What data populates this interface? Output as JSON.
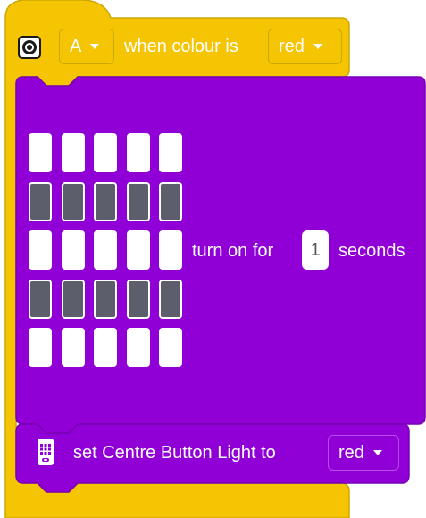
{
  "hat_block": {
    "port": "A",
    "label": "when colour is",
    "colour": "red"
  },
  "matrix_block": {
    "grid": [
      [
        0,
        0,
        0,
        0,
        0
      ],
      [
        1,
        1,
        1,
        1,
        1
      ],
      [
        0,
        0,
        0,
        0,
        0
      ],
      [
        1,
        1,
        1,
        1,
        1
      ],
      [
        0,
        0,
        0,
        0,
        0
      ]
    ],
    "label_prefix": "turn on for",
    "duration": "1",
    "label_suffix": "seconds"
  },
  "light_block": {
    "label": "set Centre Button Light to",
    "colour": "red"
  },
  "colors": {
    "event_yellow": "#F5C402",
    "event_border": "#CCA802",
    "display_purple": "#9000D6",
    "display_border": "#7800B3"
  },
  "icons": {
    "hat": "color-sensor-icon",
    "light": "hub-light-icon"
  }
}
